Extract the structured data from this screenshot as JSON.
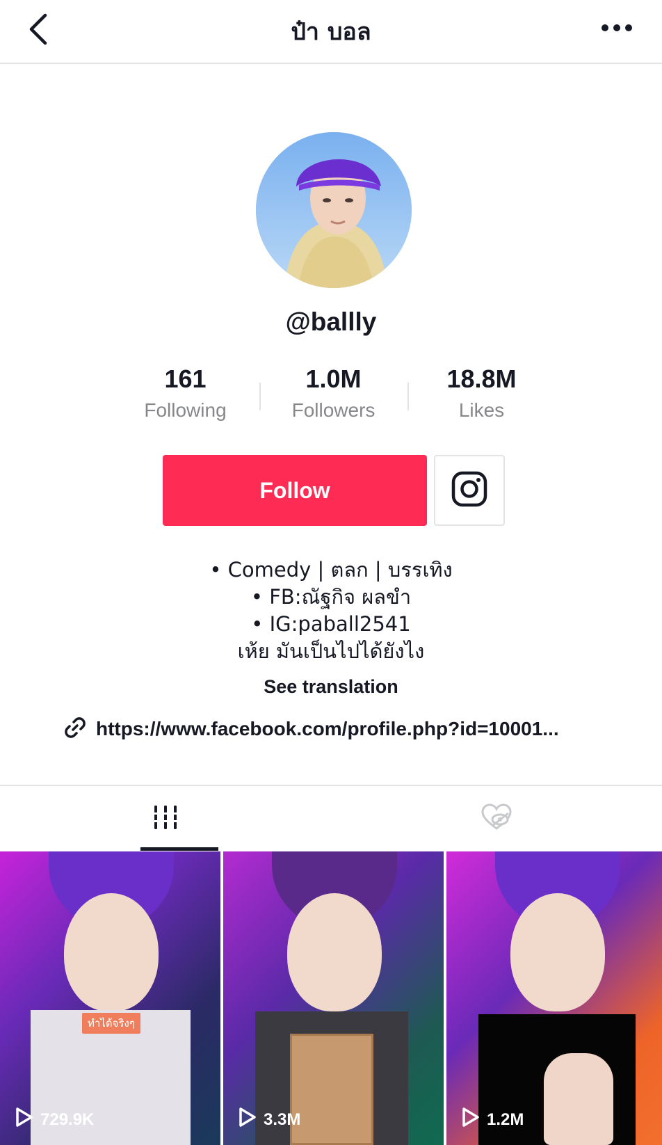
{
  "header": {
    "title": "ป๋า บอล",
    "back_icon": "chevron-left-icon",
    "more_icon": "more-horizontal-icon"
  },
  "profile": {
    "username": "@ballly",
    "avatar_alt": "profile-avatar"
  },
  "stats": [
    {
      "value": "161",
      "label": "Following"
    },
    {
      "value": "1.0M",
      "label": "Followers"
    },
    {
      "value": "18.8M",
      "label": "Likes"
    }
  ],
  "actions": {
    "follow_label": "Follow",
    "instagram_icon": "instagram-icon"
  },
  "bio": {
    "lines": [
      "• Comedy | ตลก | บรรเทิง",
      "• FB:ณัฐกิจ ผลขำ",
      "• IG:paball2541",
      "เห้ย มันเป็นไปได้ยังไง"
    ],
    "translate_label": "See translation",
    "link_text": "https://www.facebook.com/profile.php?id=10001..."
  },
  "tabs": [
    {
      "name": "videos",
      "icon": "grid-bars-icon",
      "active": true
    },
    {
      "name": "liked",
      "icon": "heart-hidden-icon",
      "active": false
    }
  ],
  "videos": [
    {
      "views": "729.9K",
      "tag": "ทำได้จริงๆ"
    },
    {
      "views": "3.3M"
    },
    {
      "views": "1.2M"
    }
  ],
  "colors": {
    "accent": "#fe2c55",
    "text_primary": "#161823",
    "text_secondary": "#86878b",
    "divider": "#e3e3e4"
  }
}
